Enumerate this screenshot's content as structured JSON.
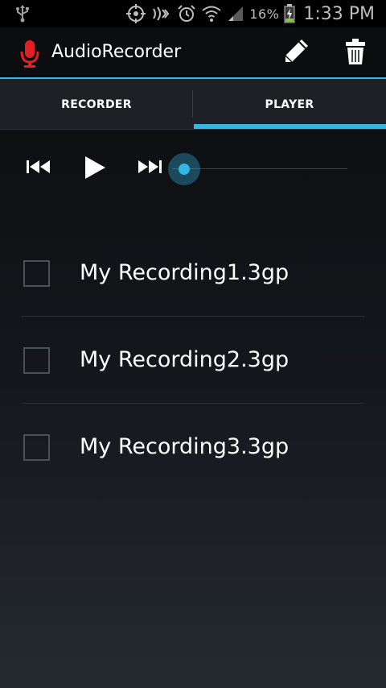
{
  "status_bar": {
    "battery_percent": "16%",
    "time": "1:33 PM",
    "icons": [
      "usb-icon",
      "location-icon",
      "nfc-icon",
      "alarm-icon",
      "wifi-icon",
      "signal-icon",
      "battery-charging-icon"
    ]
  },
  "action_bar": {
    "title": "AudioRecorder",
    "icons": [
      "microphone-icon",
      "pencil-icon",
      "trash-icon"
    ]
  },
  "tabs": [
    {
      "label": "RECORDER",
      "selected": false
    },
    {
      "label": "PLAYER",
      "selected": true
    }
  ],
  "player": {
    "controls": [
      "previous-icon",
      "play-icon",
      "next-icon"
    ],
    "seek_progress": 0
  },
  "recordings": [
    {
      "name": "My Recording1.3gp",
      "checked": false
    },
    {
      "name": "My Recording2.3gp",
      "checked": false
    },
    {
      "name": "My Recording3.3gp",
      "checked": false
    }
  ],
  "colors": {
    "accent": "#33b5e5",
    "mic_red": "#e31e24"
  }
}
